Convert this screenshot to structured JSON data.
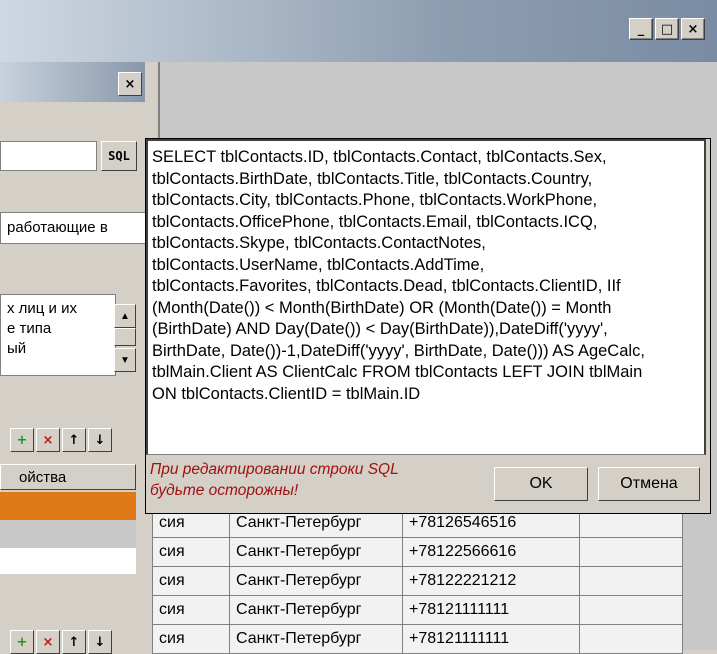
{
  "window": {
    "minimize": "_",
    "maximize": "□",
    "close": "×"
  },
  "left_panel": {
    "close": "×",
    "sql_button": "SQL",
    "filter_text": "работающие в",
    "memo_lines": [
      "х лиц и их",
      "е типа",
      "ый"
    ],
    "toolbar1": [
      "+",
      "×",
      "↑",
      "↓"
    ],
    "toolbar2": [
      "+",
      "×",
      "↑",
      "↓"
    ],
    "props_header": "ойства"
  },
  "dialog": {
    "sql_lines": [
      "SELECT tblContacts.ID, tblContacts.Contact, tblContacts.Sex,",
      "tblContacts.BirthDate, tblContacts.Title, tblContacts.Country,",
      "tblContacts.City, tblContacts.Phone, tblContacts.WorkPhone,",
      "tblContacts.OfficePhone, tblContacts.Email, tblContacts.ICQ,",
      "tblContacts.Skype, tblContacts.ContactNotes,",
      "tblContacts.UserName, tblContacts.AddTime,",
      "tblContacts.Favorites, tblContacts.Dead, tblContacts.ClientID, IIf",
      "(Month(Date()) < Month(BirthDate) OR (Month(Date()) = Month",
      "(BirthDate) AND Day(Date()) < Day(BirthDate)),DateDiff('yyyy',",
      "BirthDate, Date())-1,DateDiff('yyyy', BirthDate, Date())) AS AgeCalc,",
      "tblMain.Client AS ClientCalc FROM tblContacts LEFT JOIN tblMain",
      "ON tblContacts.ClientID = tblMain.ID"
    ],
    "warning_lines": [
      "При редактировании строки SQL",
      "будьте осторожны!"
    ],
    "ok": "OK",
    "cancel": "Отмена"
  },
  "grid_rows": [
    {
      "country": "сия",
      "city": "Санкт-Петербург",
      "phone": "+78126546516"
    },
    {
      "country": "сия",
      "city": "Санкт-Петербург",
      "phone": "+78122566616"
    },
    {
      "country": "сия",
      "city": "Санкт-Петербург",
      "phone": "+78122221212"
    },
    {
      "country": "сия",
      "city": "Санкт-Петербург",
      "phone": "+78121111111"
    },
    {
      "country": "сия",
      "city": "Санкт-Петербург",
      "phone": "+78121111111"
    }
  ],
  "colors": {
    "accent": "#e07a18",
    "warning": "#a01010"
  }
}
